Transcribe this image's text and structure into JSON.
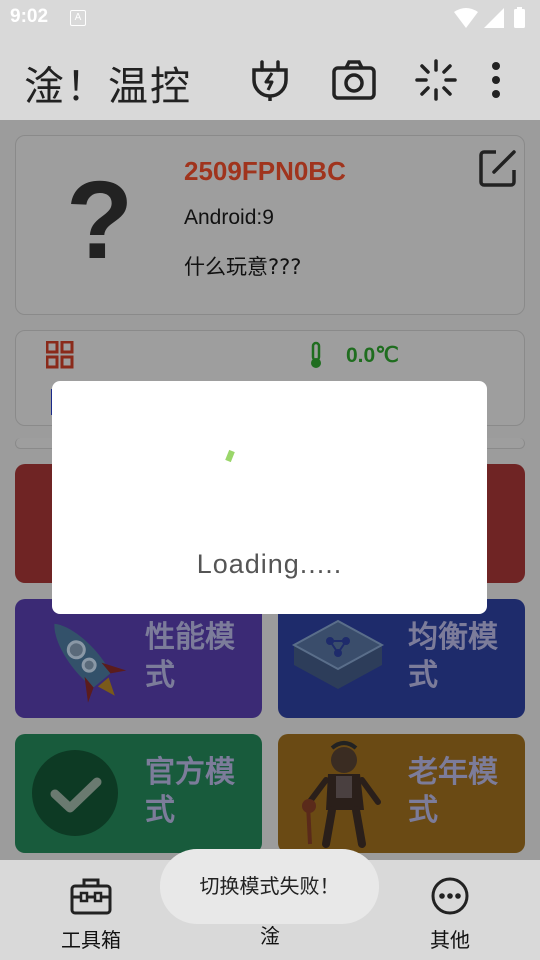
{
  "status": {
    "time": "9:02",
    "indicator": "A"
  },
  "appbar": {
    "title": "淦！温控",
    "icons": [
      "plug-icon",
      "camera-icon",
      "loading-icon",
      "more-vertical-icon"
    ]
  },
  "device": {
    "model": "2509FPN0BC",
    "android": "Android:9",
    "nickname": "什么玩意???"
  },
  "stats": {
    "temperature": "0.0℃"
  },
  "modes": [
    {
      "label": "性能模式",
      "color": "#3b2a75"
    },
    {
      "label": "均衡模式",
      "color": "#1e2b6b"
    },
    {
      "label": "官方模式",
      "color": "#185b3c"
    },
    {
      "label": "老年模式",
      "color": "#6a4a14"
    }
  ],
  "dialog": {
    "loading": "Loading....."
  },
  "nav": {
    "tools": "工具箱",
    "center": "淦",
    "other": "其他"
  },
  "toast": {
    "message": "切换模式失败！"
  }
}
